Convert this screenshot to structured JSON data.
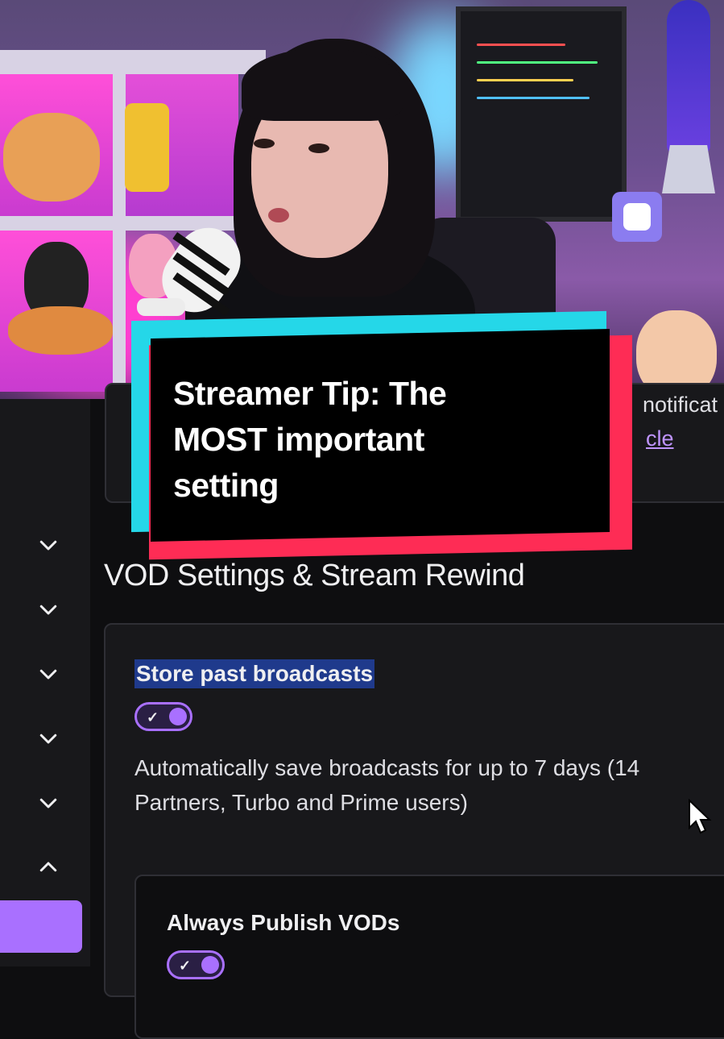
{
  "caption": {
    "line1": "Streamer Tip: The",
    "line2": "MOST important",
    "line3": "setting"
  },
  "previous_card": {
    "text_fragment": "notificat",
    "link_fragment": "cle"
  },
  "vod_section": {
    "title": "VOD Settings & Stream Rewind",
    "store_past_broadcasts": {
      "label": "Store past broadcasts",
      "enabled": true,
      "description_line1": "Automatically save broadcasts for up to 7 days (14",
      "description_line2": "Partners, Turbo and Prime users)"
    },
    "always_publish": {
      "label": "Always Publish VODs",
      "enabled": true
    }
  },
  "left_rail": {
    "chevrons": [
      "chevron-down-icon",
      "chevron-down-icon",
      "chevron-down-icon",
      "chevron-down-icon",
      "chevron-down-icon",
      "chevron-up-icon"
    ]
  },
  "colors": {
    "twitch_purple": "#a970ff",
    "caption_cyan": "#25d7e8",
    "caption_red": "#fe2c55",
    "highlight_blue": "#1f3a8c"
  }
}
